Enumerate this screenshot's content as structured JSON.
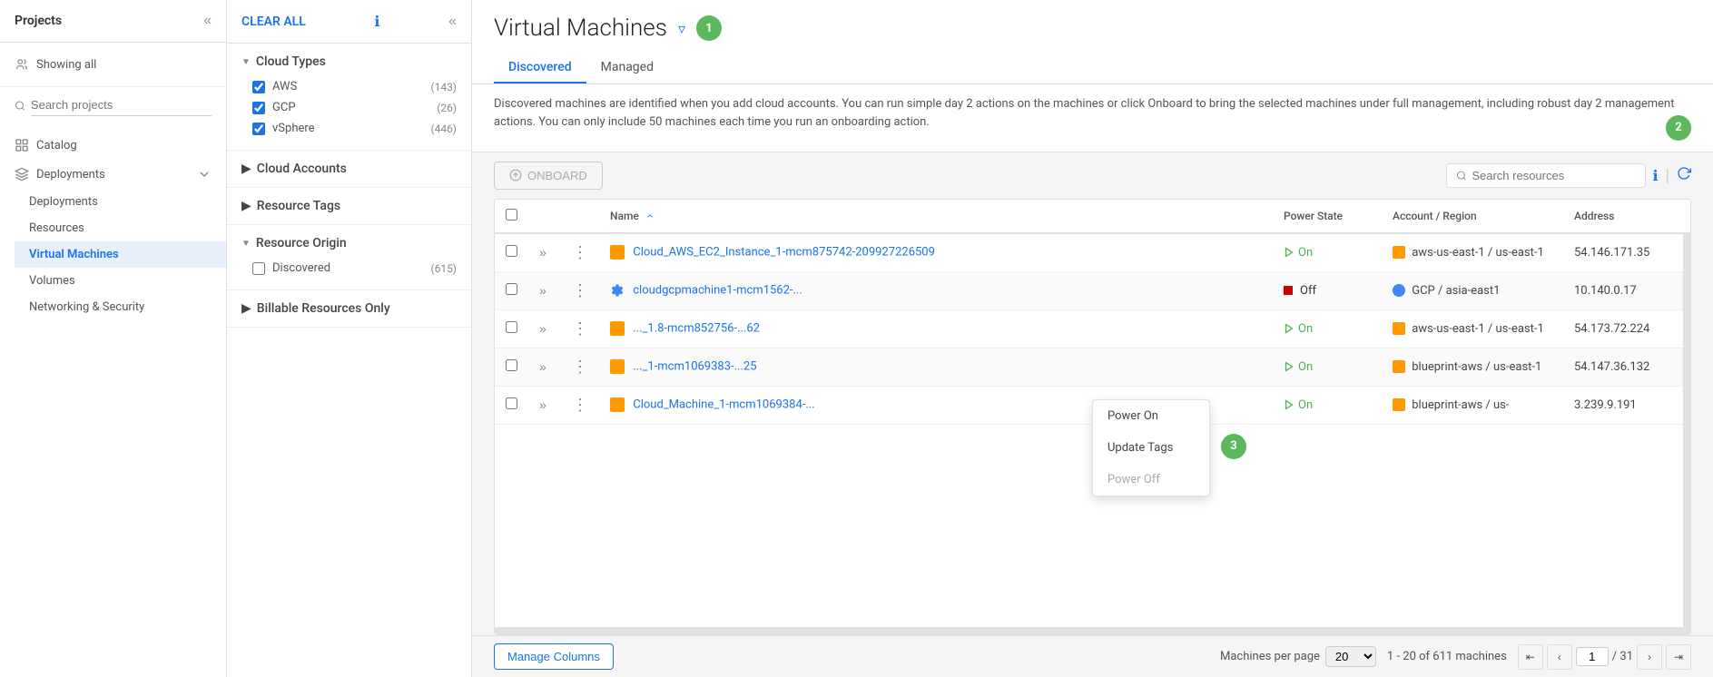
{
  "sidebar": {
    "collapse_label": "«",
    "header": "Projects",
    "showing": "Showing all",
    "search_placeholder": "Search projects",
    "nav_items": [
      {
        "id": "catalog",
        "label": "Catalog",
        "icon": "grid-icon"
      },
      {
        "id": "deployments",
        "label": "Deployments",
        "icon": "layers-icon",
        "expanded": true,
        "children": [
          {
            "id": "deployments-sub",
            "label": "Deployments"
          },
          {
            "id": "resources",
            "label": "Resources"
          },
          {
            "id": "virtual-machines",
            "label": "Virtual Machines",
            "active": true
          },
          {
            "id": "volumes",
            "label": "Volumes"
          },
          {
            "id": "networking-security",
            "label": "Networking & Security"
          }
        ]
      }
    ]
  },
  "filter_panel": {
    "clear_all": "CLEAR ALL",
    "info_icon": "ℹ",
    "collapse_icon": "«",
    "sections": [
      {
        "id": "cloud-types",
        "label": "Cloud Types",
        "expanded": true,
        "items": [
          {
            "label": "AWS",
            "checked": true,
            "count": "(143)"
          },
          {
            "label": "GCP",
            "checked": true,
            "count": "(26)"
          },
          {
            "label": "vSphere",
            "checked": true,
            "count": "(446)"
          }
        ]
      },
      {
        "id": "cloud-accounts",
        "label": "Cloud Accounts",
        "expanded": false
      },
      {
        "id": "resource-tags",
        "label": "Resource Tags",
        "expanded": false
      },
      {
        "id": "resource-origin",
        "label": "Resource Origin",
        "expanded": true,
        "items": [
          {
            "label": "Discovered",
            "checked": false,
            "count": "(615)"
          }
        ]
      },
      {
        "id": "billable-resources",
        "label": "Billable Resources Only",
        "expanded": false
      }
    ]
  },
  "main": {
    "title": "Virtual Machines",
    "badge1": "1",
    "badge2": "2",
    "badge3": "3",
    "tabs": [
      {
        "id": "discovered",
        "label": "Discovered",
        "active": true
      },
      {
        "id": "managed",
        "label": "Managed",
        "active": false
      }
    ],
    "description": "Discovered machines are identified when you add cloud accounts. You can run simple day 2 actions on the machines or click Onboard to bring the selected machines under full management, including robust day 2 management actions. You can only include 50 machines each time you run an onboarding action.",
    "onboard_button": "ONBOARD",
    "search_placeholder": "Search resources",
    "table": {
      "columns": [
        "",
        "",
        "",
        "Name",
        "Power State",
        "Account / Region",
        "Address"
      ],
      "rows": [
        {
          "icon_type": "aws",
          "name": "Cloud_AWS_EC2_Instance_1-mcm875742-209927226509",
          "power_state": "On",
          "power_on": true,
          "account": "aws-us-east-1 / us-east-1",
          "account_type": "aws",
          "address": "54.146.171.35"
        },
        {
          "icon_type": "gcp",
          "name": "cloudgcpmachine1-mcm1562-...",
          "power_state": "Off",
          "power_on": false,
          "account": "GCP / asia-east1",
          "account_type": "gcp",
          "address": "10.140.0.17"
        },
        {
          "icon_type": "aws",
          "name": "..._1.8-mcm852756-...62",
          "power_state": "On",
          "power_on": true,
          "account": "aws-us-east-1 / us-east-1",
          "account_type": "aws",
          "address": "54.173.72.224"
        },
        {
          "icon_type": "aws",
          "name": "..._1-mcm1069383-...25",
          "power_state": "On",
          "power_on": true,
          "account": "blueprint-aws / us-east-1",
          "account_type": "aws",
          "address": "54.147.36.132"
        },
        {
          "icon_type": "aws",
          "name": "Cloud_Machine_1-mcm1069384-...",
          "power_state": "On",
          "power_on": true,
          "account": "blueprint-aws / us-",
          "account_type": "aws",
          "address": "3.239.9.191"
        }
      ]
    },
    "context_menu": {
      "items": [
        {
          "label": "Power On",
          "disabled": false
        },
        {
          "label": "Update Tags",
          "disabled": false
        },
        {
          "label": "Power Off",
          "disabled": true
        }
      ]
    },
    "footer": {
      "manage_columns": "Manage Columns",
      "per_page_label": "Machines per page",
      "per_page_value": "20",
      "total_label": "1 - 20 of 611 machines",
      "current_page": "1",
      "total_pages": "31"
    }
  }
}
